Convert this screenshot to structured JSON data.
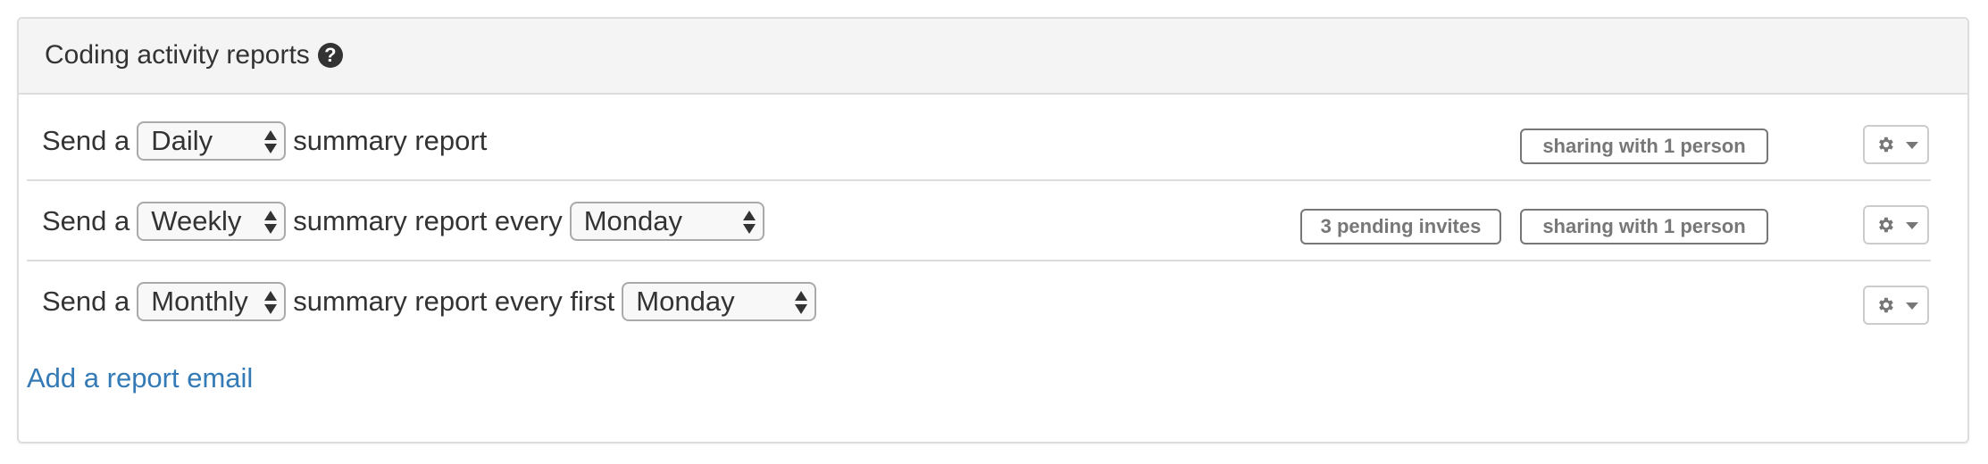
{
  "panel": {
    "title": "Coding activity reports",
    "help_icon": "question-circle-icon",
    "help_glyph": "?"
  },
  "rows": [
    {
      "prefix": "Send a",
      "frequency": "Daily",
      "middle": "summary report",
      "badges": {
        "sharing": "sharing with 1 person"
      },
      "gear_icon": "gear-icon",
      "caret_icon": "caret-down-icon"
    },
    {
      "prefix": "Send a",
      "frequency": "Weekly",
      "middle": "summary report every",
      "day": "Monday",
      "badges": {
        "pending": "3 pending invites",
        "sharing": "sharing with 1 person"
      },
      "gear_icon": "gear-icon",
      "caret_icon": "caret-down-icon"
    },
    {
      "prefix": "Send a",
      "frequency": "Monthly",
      "middle": "summary report every first",
      "day": "Monday",
      "gear_icon": "gear-icon",
      "caret_icon": "caret-down-icon"
    }
  ],
  "add_link": "Add a report email",
  "colors": {
    "link": "#337ab7",
    "badge": "#777777",
    "heading_bg": "#f4f4f4",
    "border": "#dddddd"
  }
}
